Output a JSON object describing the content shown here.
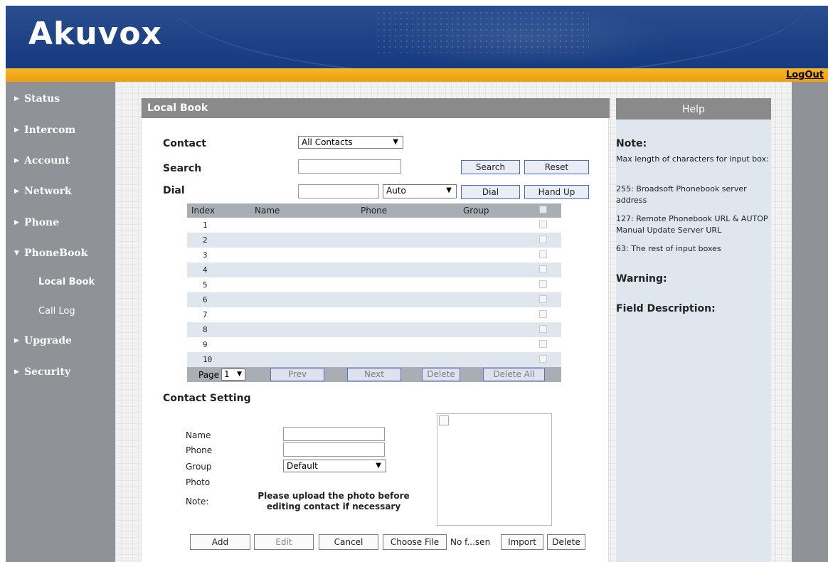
{
  "header": {
    "logo": "Akuvox",
    "logout": "LogOut"
  },
  "colors": {
    "header_blue": "#1f4286",
    "orange_bar": "#f0a512",
    "sidebar_gray": "#8f9296",
    "button_border": "#4a66c8"
  },
  "sidebar": {
    "items": [
      {
        "label": "Status"
      },
      {
        "label": "Intercom"
      },
      {
        "label": "Account"
      },
      {
        "label": "Network"
      },
      {
        "label": "Phone"
      },
      {
        "label": "PhoneBook",
        "expanded": true
      },
      {
        "label": "Upgrade"
      },
      {
        "label": "Security"
      }
    ],
    "subitems": [
      {
        "label": "Local Book",
        "active": true
      },
      {
        "label": "Call Log"
      }
    ]
  },
  "local_book": {
    "title": "Local Book",
    "contact_label": "Contact",
    "contact_value": "All Contacts",
    "search_label": "Search",
    "search_value": "",
    "search_button": "Search",
    "reset_button": "Reset",
    "dial_label": "Dial",
    "dial_value": "",
    "dial_mode": "Auto",
    "dial_button": "Dial",
    "hangup_button": "Hand Up",
    "table": {
      "headers": {
        "index": "Index",
        "name": "Name",
        "phone": "Phone",
        "group": "Group"
      },
      "rows": [
        "1",
        "2",
        "3",
        "4",
        "5",
        "6",
        "7",
        "8",
        "9",
        "10"
      ]
    },
    "pager": {
      "page_label": "Page",
      "page_value": "1",
      "prev": "Prev",
      "next": "Next",
      "delete": "Delete",
      "delete_all": "Delete All"
    }
  },
  "contact_setting": {
    "title": "Contact Setting",
    "name_label": "Name",
    "phone_label": "Phone",
    "group_label": "Group",
    "group_value": "Default",
    "photo_label": "Photo",
    "note_label": "Note:",
    "note_line1": "Please upload the photo before",
    "note_line2": "editing contact if necessary",
    "buttons": {
      "add": "Add",
      "edit": "Edit",
      "cancel": "Cancel",
      "choose_file": "Choose File",
      "no_file": "No f...sen",
      "import": "Import",
      "delete": "Delete"
    }
  },
  "help": {
    "title": "Help",
    "note_heading": "Note:",
    "note_lines": [
      "Max length of characters for input box:",
      "255: Broadsoft Phonebook server address",
      "127: Remote Phonebook URL & AUTOP Manual Update Server URL",
      "63: The rest of input boxes"
    ],
    "warning_heading": "Warning:",
    "field_heading": "Field Description:"
  }
}
